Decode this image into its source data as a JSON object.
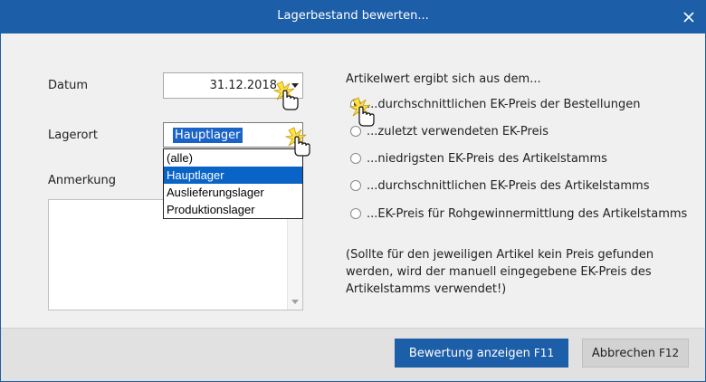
{
  "window": {
    "title": "Lagerbestand bewerten..."
  },
  "form": {
    "datum_label": "Datum",
    "datum_value": "31.12.2018",
    "lagerort_label": "Lagerort",
    "lagerort_selected": "Hauptlager",
    "lagerort_options": [
      "(alle)",
      "Hauptlager",
      "Auslieferungslager",
      "Produktionslager"
    ],
    "anmerkung_label": "Anmerkung",
    "anmerkung_value": ""
  },
  "artikelwert": {
    "heading": "Artikelwert ergibt sich aus dem...",
    "options": [
      {
        "label": "...durchschnittlichen EK-Preis der Bestellungen",
        "checked": true
      },
      {
        "label": "...zuletzt verwendeten EK-Preis",
        "checked": false
      },
      {
        "label": "...niedrigsten EK-Preis des Artikelstamms",
        "checked": false
      },
      {
        "label": "...durchschnittlichen EK-Preis des Artikelstamms",
        "checked": false
      },
      {
        "label": "...EK-Preis für Rohgewinnermittlung des Artikelstamms",
        "checked": false
      }
    ],
    "note": "(Sollte für den jeweiligen Artikel kein Preis gefunden werden, wird der manuell eingegebene EK-Preis des Artikelstamms verwendet!)"
  },
  "buttons": {
    "show_label": "Bewertung anzeigen",
    "show_key": "F11",
    "cancel_label": "Abbrechen",
    "cancel_key": "F12"
  },
  "colors": {
    "accent": "#1d5ea8",
    "selection": "#0a64c8"
  }
}
